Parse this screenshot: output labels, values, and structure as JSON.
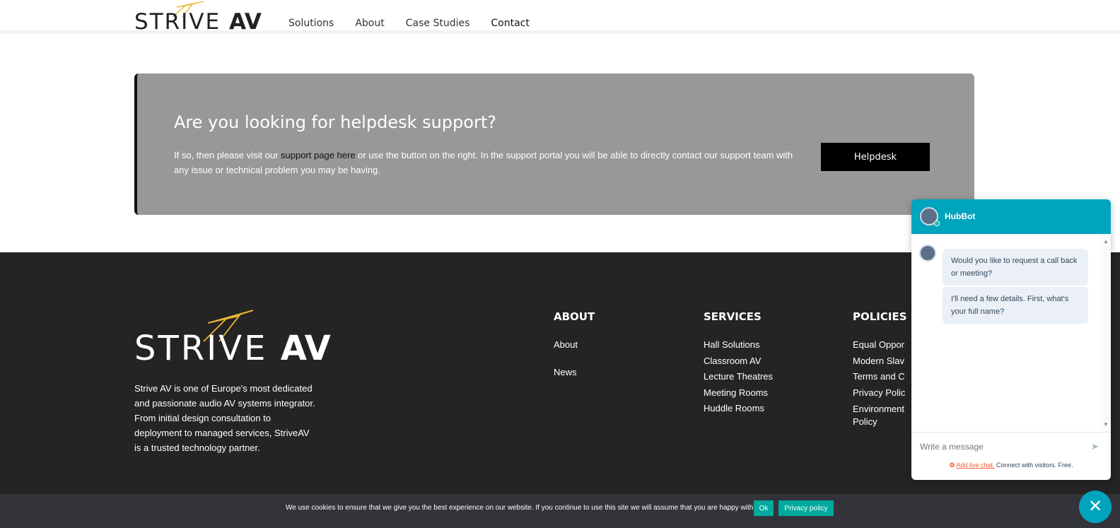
{
  "colors": {
    "accent_teal": "#00a4bd",
    "cookie_button": "#00a99d",
    "banner_bg": "#989898",
    "footer_bg": "#242424",
    "logo_gold": "#e9b530"
  },
  "header": {
    "logo": {
      "text_light": "STRIVE",
      "text_bold": "AV"
    },
    "nav": [
      "Solutions",
      "About",
      "Case Studies",
      "Contact"
    ]
  },
  "banner": {
    "title": "Are you looking for helpdesk support?",
    "text_before": "If so, then please visit our ",
    "link_text": "support page here",
    "text_after": " or use the button on the right. In the support portal you will be able to directly contact our support team with any issue or technical problem you may be having.",
    "button_label": "Helpdesk"
  },
  "footer": {
    "logo": {
      "text_light": "STRIVE",
      "text_bold": "AV"
    },
    "description": "Strive AV is one of Europe's most dedicated and passionate audio AV systems integrator. From initial design consultation to deployment to managed services, StriveAV is a trusted technology partner.",
    "about": {
      "heading": "ABOUT",
      "links": [
        "About",
        "News"
      ]
    },
    "services": {
      "heading": "SERVICES",
      "links": [
        "Hall Solutions",
        "Classroom AV",
        "Lecture Theatres",
        "Meeting Rooms",
        "Huddle Rooms"
      ]
    },
    "policies": {
      "heading": "POLICIES",
      "links": [
        "Equal Oppor",
        "Modern Slav",
        "Terms and C",
        "Privacy Polic",
        "Environment",
        "Policy"
      ]
    }
  },
  "cookie": {
    "text": "We use cookies to ensure that we give you the best experience on our website. If you continue to use this site we will assume that you are happy with it.",
    "ok_label": "Ok",
    "privacy_label": "Privacy policy"
  },
  "chat": {
    "bot_name": "HubBot",
    "messages": [
      "Would you like to request a call back or meeting?",
      "I'll need a few details. First, what's your full name?"
    ],
    "input_placeholder": "Write a message",
    "footer_link": "Add live chat.",
    "footer_text": " Connect with visitors. Free.",
    "close_glyph": "✕",
    "send_glyph": "➤"
  }
}
